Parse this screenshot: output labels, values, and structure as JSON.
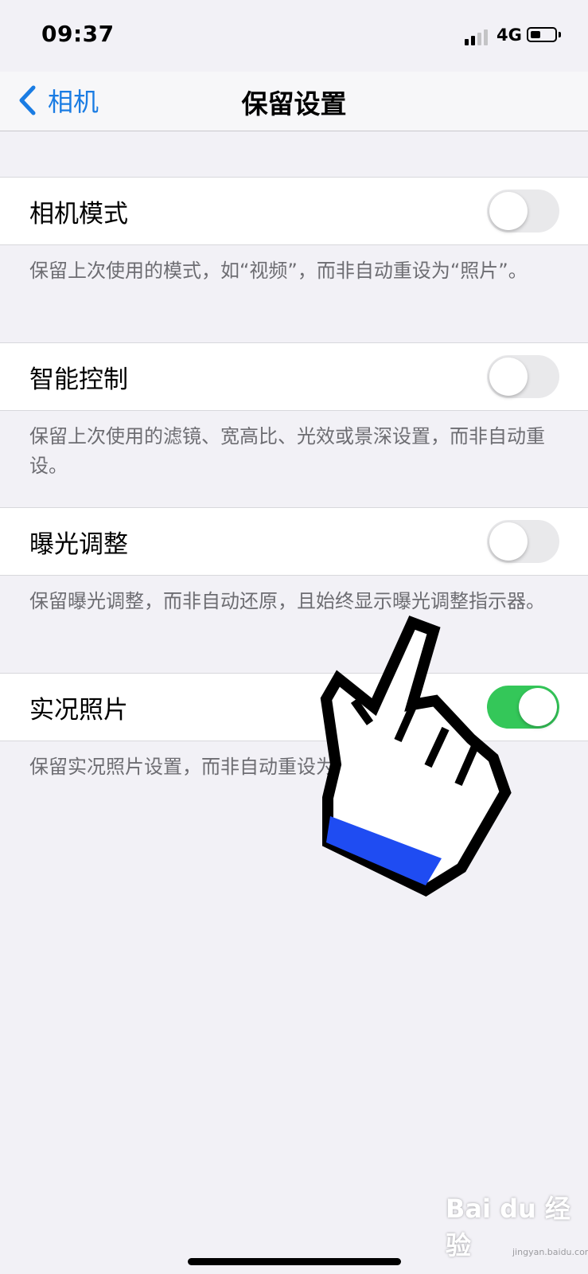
{
  "status": {
    "time": "09:37",
    "network": "4G"
  },
  "nav": {
    "back_label": "相机",
    "title": "保留设置"
  },
  "settings": [
    {
      "label": "相机模式",
      "on": false,
      "footer": "保留上次使用的模式，如“视频”，而非自动重设为“照片”。"
    },
    {
      "label": "智能控制",
      "on": false,
      "footer": "保留上次使用的滤镜、宽高比、光效或景深设置，而非自动重设。"
    },
    {
      "label": "曝光调整",
      "on": false,
      "footer": "保留曝光调整，而非自动还原，且始终显示曝光调整指示器。"
    },
    {
      "label": "实况照片",
      "on": true,
      "footer": "保留实况照片设置，而非自动重设为打开。"
    }
  ],
  "watermark": {
    "text": "Bai du 经验",
    "sub": "jingyan.baidu.com"
  },
  "colors": {
    "accent": "#1a7ce3",
    "toggle_on": "#34c759",
    "toggle_off": "#e9e9eb",
    "background": "#f2f1f6"
  },
  "icons": [
    "signal-icon",
    "battery-icon",
    "back-chevron-icon",
    "pointer-hand-icon"
  ]
}
